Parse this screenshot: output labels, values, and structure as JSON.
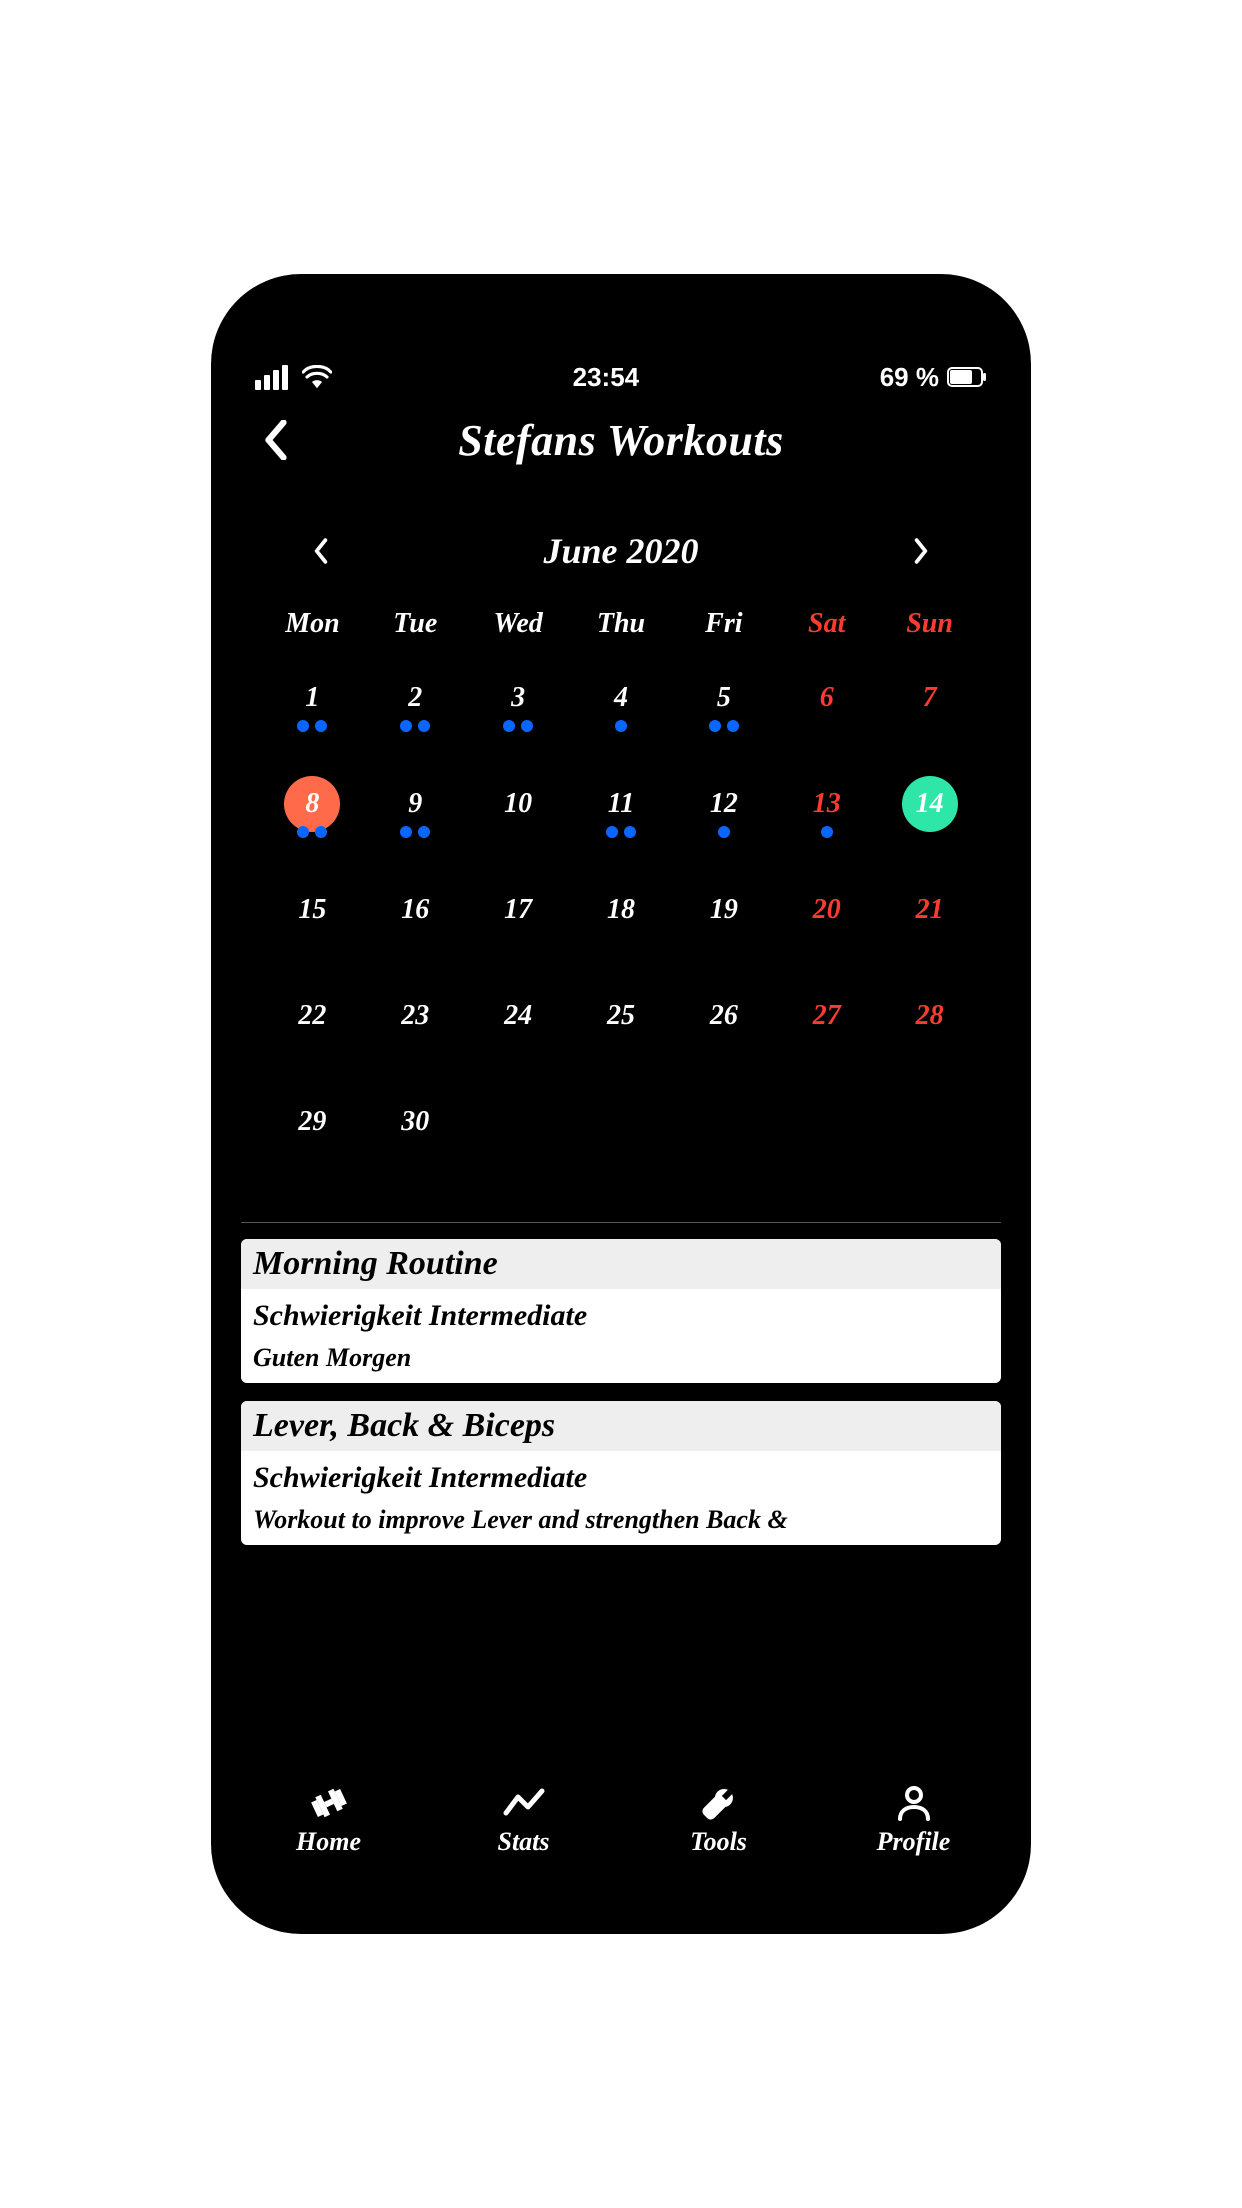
{
  "status": {
    "time": "23:54",
    "battery_text": "69 %"
  },
  "header": {
    "title": "Stefans Workouts"
  },
  "calendar": {
    "month_label": "June 2020",
    "daynames": [
      "Mon",
      "Tue",
      "Wed",
      "Thu",
      "Fri",
      "Sat",
      "Sun"
    ],
    "weekend_indices": [
      5,
      6
    ],
    "days": [
      {
        "n": "1",
        "weekend": false,
        "dots": 2
      },
      {
        "n": "2",
        "weekend": false,
        "dots": 2
      },
      {
        "n": "3",
        "weekend": false,
        "dots": 2
      },
      {
        "n": "4",
        "weekend": false,
        "dots": 1
      },
      {
        "n": "5",
        "weekend": false,
        "dots": 2
      },
      {
        "n": "6",
        "weekend": true,
        "dots": 0
      },
      {
        "n": "7",
        "weekend": true,
        "dots": 0
      },
      {
        "n": "8",
        "weekend": false,
        "dots": 2,
        "selected": true
      },
      {
        "n": "9",
        "weekend": false,
        "dots": 2
      },
      {
        "n": "10",
        "weekend": false,
        "dots": 0
      },
      {
        "n": "11",
        "weekend": false,
        "dots": 2
      },
      {
        "n": "12",
        "weekend": false,
        "dots": 1
      },
      {
        "n": "13",
        "weekend": true,
        "dots": 1
      },
      {
        "n": "14",
        "weekend": true,
        "dots": 0,
        "today": true
      },
      {
        "n": "15",
        "weekend": false,
        "dots": 0
      },
      {
        "n": "16",
        "weekend": false,
        "dots": 0
      },
      {
        "n": "17",
        "weekend": false,
        "dots": 0
      },
      {
        "n": "18",
        "weekend": false,
        "dots": 0
      },
      {
        "n": "19",
        "weekend": false,
        "dots": 0
      },
      {
        "n": "20",
        "weekend": true,
        "dots": 0
      },
      {
        "n": "21",
        "weekend": true,
        "dots": 0
      },
      {
        "n": "22",
        "weekend": false,
        "dots": 0
      },
      {
        "n": "23",
        "weekend": false,
        "dots": 0
      },
      {
        "n": "24",
        "weekend": false,
        "dots": 0
      },
      {
        "n": "25",
        "weekend": false,
        "dots": 0
      },
      {
        "n": "26",
        "weekend": false,
        "dots": 0
      },
      {
        "n": "27",
        "weekend": true,
        "dots": 0
      },
      {
        "n": "28",
        "weekend": true,
        "dots": 0
      },
      {
        "n": "29",
        "weekend": false,
        "dots": 0
      },
      {
        "n": "30",
        "weekend": false,
        "dots": 0
      }
    ]
  },
  "workouts": [
    {
      "title": "Morning Routine",
      "difficulty": "Schwierigkeit Intermediate",
      "description": "Guten Morgen"
    },
    {
      "title": "Lever, Back & Biceps",
      "difficulty": "Schwierigkeit Intermediate",
      "description": "Workout to improve Lever and strengthen Back &"
    }
  ],
  "nav": {
    "home": "Home",
    "stats": "Stats",
    "tools": "Tools",
    "profile": "Profile"
  }
}
